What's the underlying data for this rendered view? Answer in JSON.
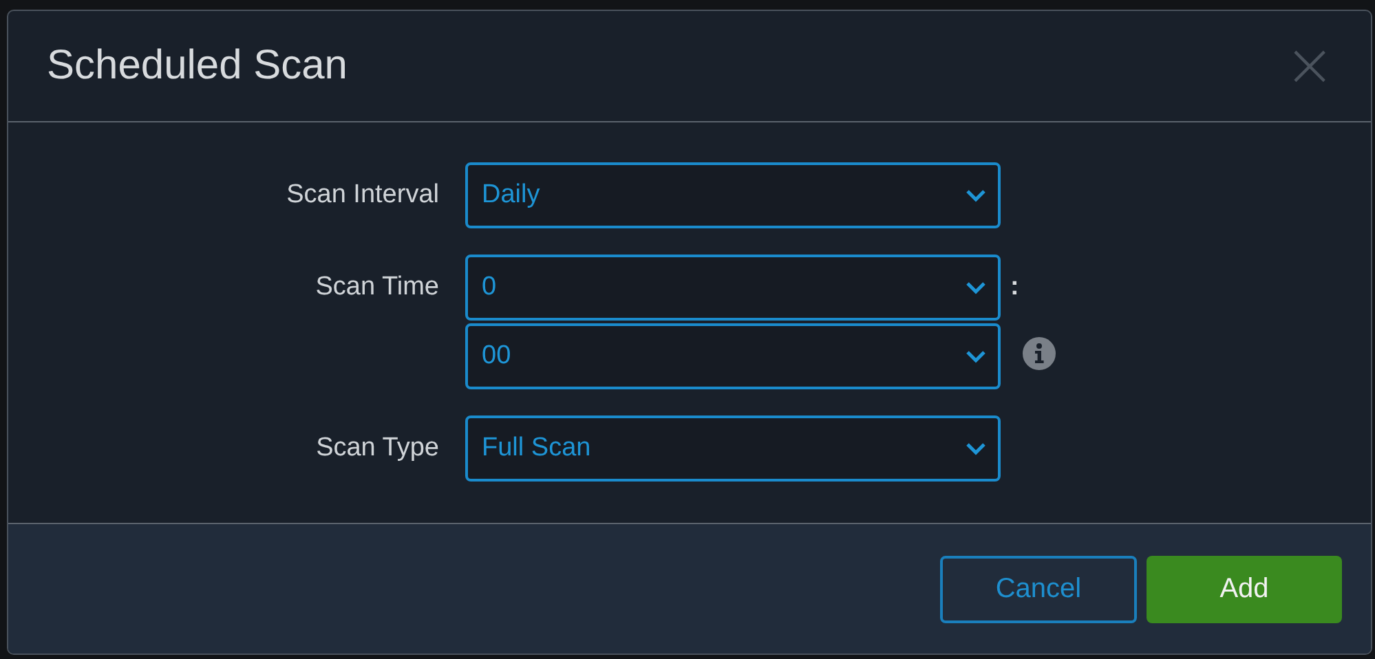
{
  "dialog": {
    "title": "Scheduled Scan",
    "close": "×"
  },
  "fields": [
    {
      "kind": "select",
      "label": "Scan Interval",
      "value": "Daily"
    },
    {
      "kind": "time",
      "label": "Scan Time",
      "hours": "0",
      "separator": ":",
      "minutes": "00"
    },
    {
      "kind": "select",
      "label": "Scan Type",
      "value": "Full Scan"
    }
  ],
  "buttons": [
    {
      "kind": "secondary",
      "label": "Cancel"
    },
    {
      "kind": "primary",
      "label": "Add"
    }
  ]
}
